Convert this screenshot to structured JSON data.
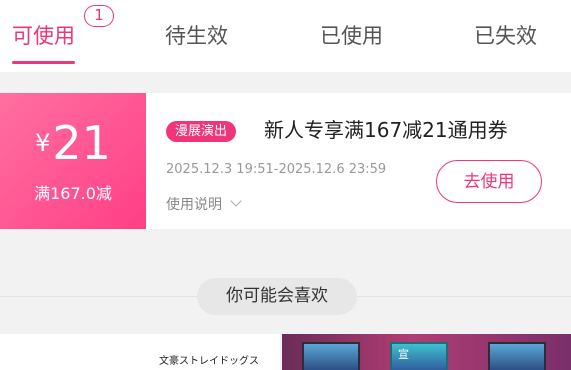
{
  "tabs": {
    "available": {
      "label": "可使用",
      "count": "1"
    },
    "pending": {
      "label": "待生效"
    },
    "used": {
      "label": "已使用"
    },
    "expired": {
      "label": "已失效"
    }
  },
  "coupon": {
    "currency": "¥",
    "amount": "21",
    "threshold": "满167.0减",
    "badge": "漫展演出",
    "title": "新人专享满167减21通用券",
    "validity": "2025.12.3 19:51-2025.12.6 23:59",
    "rules_label": "使用说明",
    "use_button": "去使用"
  },
  "recommend": {
    "title": "你可能会喜欢"
  },
  "products": {
    "left_caption": "文豪ストレイドッグス",
    "poster_text": "宣"
  },
  "colors": {
    "accent": "#f0367a",
    "coupon_gradient_start": "#ff6fa0",
    "coupon_gradient_end": "#ff3f86"
  }
}
